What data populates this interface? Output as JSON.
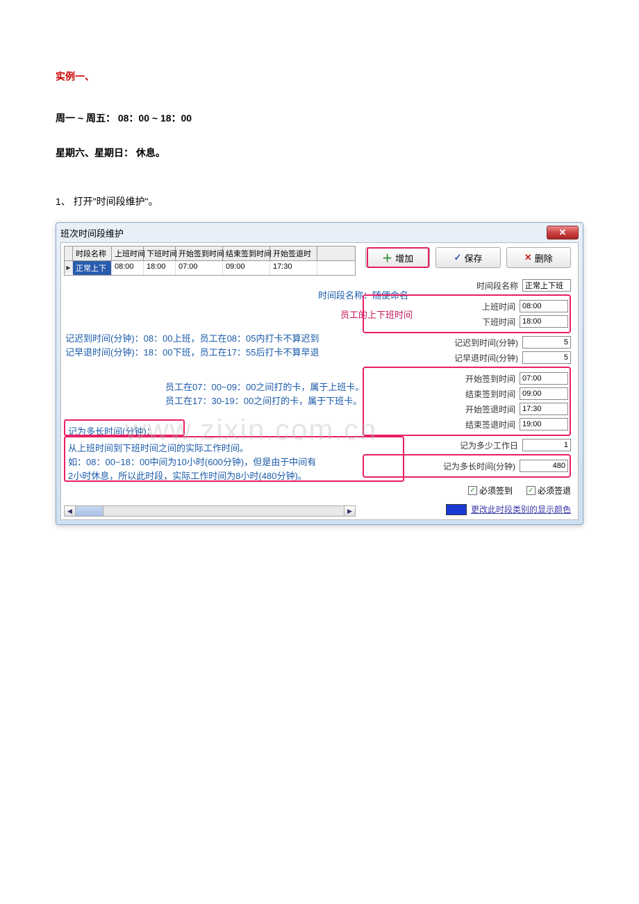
{
  "doc": {
    "example_title": "实例一、",
    "schedule_weekday": "周一 ~ 周五： 08：00 ~ 18：00",
    "schedule_weekend": "星期六、星期日： 休息。",
    "step1": "1、 打开\"时间段维护\"。",
    "watermark": "www.zixin.com.cn"
  },
  "window": {
    "title": "班次时间段维护",
    "close": "✕"
  },
  "grid": {
    "headers": [
      "时段名称",
      "上班时间",
      "下班时间",
      "开始签到时间",
      "结束签到时间",
      "开始签退时"
    ],
    "row": [
      "正常上下",
      "08:00",
      "18:00",
      "07:00",
      "09:00",
      "17:30"
    ]
  },
  "toolbar": {
    "add": "增加",
    "save": "保存",
    "delete": "删除"
  },
  "annotations": {
    "name_hint": "时间段名称：随便命名",
    "work_hint": "员工的上下班时间",
    "late_line": "记迟到时间(分钟)：08：00上班，员工在08：05内打卡不算迟到",
    "early_line": "记早退时间(分钟)：18：00下班，员工在17：55后打卡不算早退",
    "range1": "员工在07：00~09：00之间打的卡，属于上班卡。",
    "range2": "员工在17：30-19：00之间打的卡，属于下班卡。",
    "duration_title": "记为多长时间(分钟)：",
    "duration_line1": "从上班时间到下班时间之间的实际工作时间。",
    "duration_line2": "如：08：00~18：00中间为10小时(600分钟)，但是由于中间有",
    "duration_line3": "2小时休息，所以此时段，实际工作时间为8小时(480分钟)。"
  },
  "form": {
    "name_label": "时间段名称",
    "name_value": "正常上下班",
    "on_label": "上班时间",
    "on_value": "08:00",
    "off_label": "下班时间",
    "off_value": "18:00",
    "late_label": "记迟到时间(分钟)",
    "late_value": "5",
    "early_label": "记早退时间(分钟)",
    "early_value": "5",
    "ci_start_label": "开始签到时间",
    "ci_start_value": "07:00",
    "ci_end_label": "结束签到时间",
    "ci_end_value": "09:00",
    "co_start_label": "开始签退时间",
    "co_start_value": "17:30",
    "co_end_label": "结束签退时间",
    "co_end_value": "19:00",
    "days_label": "记为多少工作日",
    "days_value": "1",
    "dur_label": "记为多长时间(分钟)",
    "dur_value": "480",
    "must_in": "必须签到",
    "must_out": "必须签退",
    "color_link": "更改此时段类别的显示颜色"
  }
}
